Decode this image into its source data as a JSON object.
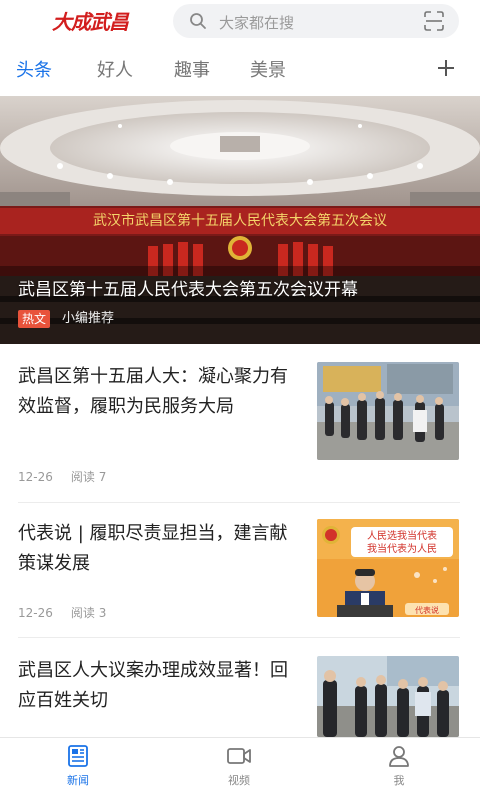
{
  "header": {
    "logo_text": "大成武昌",
    "search_placeholder": "大家都在搜"
  },
  "tabs": [
    {
      "label": "头条",
      "active": true
    },
    {
      "label": "好人",
      "active": false
    },
    {
      "label": "趣事",
      "active": false
    },
    {
      "label": "美景",
      "active": false
    }
  ],
  "hero": {
    "banner_text": "武汉市武昌区第十五届人民代表大会第五次会议",
    "title": "武昌区第十五届人民代表大会第五次会议开幕",
    "badge": "热文",
    "subtitle": "小编推荐"
  },
  "articles": [
    {
      "title": "武昌区第十五届人大：凝心聚力有效监督，履职为民服务大局",
      "date": "12-26",
      "reads": "阅读 7"
    },
    {
      "title": "代表说 | 履职尽责显担当，建言献策谋发展",
      "date": "12-26",
      "reads": "阅读 3",
      "thumb_text_1": "人民选我当代表",
      "thumb_text_2": "我当代表为人民",
      "thumb_tag": "代表说"
    },
    {
      "title": "武昌区人大议案办理成效显著！回应百姓关切"
    }
  ],
  "bottom_nav": [
    {
      "label": "新闻",
      "icon": "news-icon",
      "active": true
    },
    {
      "label": "视频",
      "icon": "video-icon",
      "active": false
    },
    {
      "label": "我",
      "icon": "user-icon",
      "active": false
    }
  ],
  "colors": {
    "accent": "#1a73e8",
    "logo_red": "#d21e1e",
    "hot_badge": "#e8533b"
  }
}
